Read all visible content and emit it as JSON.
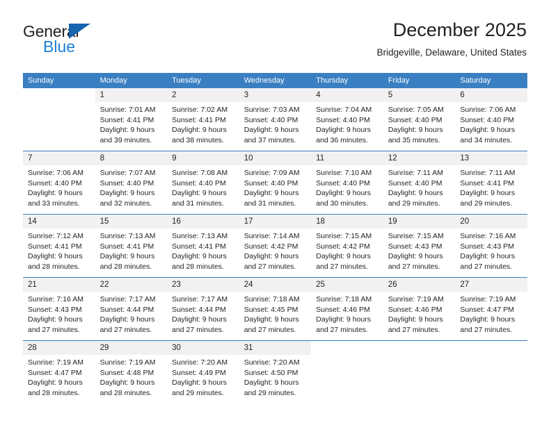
{
  "logo": {
    "word_top": "General",
    "word_bottom": "Blue",
    "triangle_name": "blue-triangle-mark",
    "color_black": "#231f20",
    "color_blue": "#1b7fd4"
  },
  "header": {
    "title": "December 2025",
    "subtitle": "Bridgeville, Delaware, United States"
  },
  "theme": {
    "header_blue": "#3a7fc1",
    "daynum_gray": "#f1f1f1",
    "text": "#231f20"
  },
  "weekday_headers": [
    "Sunday",
    "Monday",
    "Tuesday",
    "Wednesday",
    "Thursday",
    "Friday",
    "Saturday"
  ],
  "weeks": [
    {
      "days": [
        {
          "num": "",
          "lines": []
        },
        {
          "num": "1",
          "lines": [
            "Sunrise: 7:01 AM",
            "Sunset: 4:41 PM",
            "Daylight: 9 hours",
            "and 39 minutes."
          ]
        },
        {
          "num": "2",
          "lines": [
            "Sunrise: 7:02 AM",
            "Sunset: 4:41 PM",
            "Daylight: 9 hours",
            "and 38 minutes."
          ]
        },
        {
          "num": "3",
          "lines": [
            "Sunrise: 7:03 AM",
            "Sunset: 4:40 PM",
            "Daylight: 9 hours",
            "and 37 minutes."
          ]
        },
        {
          "num": "4",
          "lines": [
            "Sunrise: 7:04 AM",
            "Sunset: 4:40 PM",
            "Daylight: 9 hours",
            "and 36 minutes."
          ]
        },
        {
          "num": "5",
          "lines": [
            "Sunrise: 7:05 AM",
            "Sunset: 4:40 PM",
            "Daylight: 9 hours",
            "and 35 minutes."
          ]
        },
        {
          "num": "6",
          "lines": [
            "Sunrise: 7:06 AM",
            "Sunset: 4:40 PM",
            "Daylight: 9 hours",
            "and 34 minutes."
          ]
        }
      ]
    },
    {
      "days": [
        {
          "num": "7",
          "lines": [
            "Sunrise: 7:06 AM",
            "Sunset: 4:40 PM",
            "Daylight: 9 hours",
            "and 33 minutes."
          ]
        },
        {
          "num": "8",
          "lines": [
            "Sunrise: 7:07 AM",
            "Sunset: 4:40 PM",
            "Daylight: 9 hours",
            "and 32 minutes."
          ]
        },
        {
          "num": "9",
          "lines": [
            "Sunrise: 7:08 AM",
            "Sunset: 4:40 PM",
            "Daylight: 9 hours",
            "and 31 minutes."
          ]
        },
        {
          "num": "10",
          "lines": [
            "Sunrise: 7:09 AM",
            "Sunset: 4:40 PM",
            "Daylight: 9 hours",
            "and 31 minutes."
          ]
        },
        {
          "num": "11",
          "lines": [
            "Sunrise: 7:10 AM",
            "Sunset: 4:40 PM",
            "Daylight: 9 hours",
            "and 30 minutes."
          ]
        },
        {
          "num": "12",
          "lines": [
            "Sunrise: 7:11 AM",
            "Sunset: 4:40 PM",
            "Daylight: 9 hours",
            "and 29 minutes."
          ]
        },
        {
          "num": "13",
          "lines": [
            "Sunrise: 7:11 AM",
            "Sunset: 4:41 PM",
            "Daylight: 9 hours",
            "and 29 minutes."
          ]
        }
      ]
    },
    {
      "days": [
        {
          "num": "14",
          "lines": [
            "Sunrise: 7:12 AM",
            "Sunset: 4:41 PM",
            "Daylight: 9 hours",
            "and 28 minutes."
          ]
        },
        {
          "num": "15",
          "lines": [
            "Sunrise: 7:13 AM",
            "Sunset: 4:41 PM",
            "Daylight: 9 hours",
            "and 28 minutes."
          ]
        },
        {
          "num": "16",
          "lines": [
            "Sunrise: 7:13 AM",
            "Sunset: 4:41 PM",
            "Daylight: 9 hours",
            "and 28 minutes."
          ]
        },
        {
          "num": "17",
          "lines": [
            "Sunrise: 7:14 AM",
            "Sunset: 4:42 PM",
            "Daylight: 9 hours",
            "and 27 minutes."
          ]
        },
        {
          "num": "18",
          "lines": [
            "Sunrise: 7:15 AM",
            "Sunset: 4:42 PM",
            "Daylight: 9 hours",
            "and 27 minutes."
          ]
        },
        {
          "num": "19",
          "lines": [
            "Sunrise: 7:15 AM",
            "Sunset: 4:43 PM",
            "Daylight: 9 hours",
            "and 27 minutes."
          ]
        },
        {
          "num": "20",
          "lines": [
            "Sunrise: 7:16 AM",
            "Sunset: 4:43 PM",
            "Daylight: 9 hours",
            "and 27 minutes."
          ]
        }
      ]
    },
    {
      "days": [
        {
          "num": "21",
          "lines": [
            "Sunrise: 7:16 AM",
            "Sunset: 4:43 PM",
            "Daylight: 9 hours",
            "and 27 minutes."
          ]
        },
        {
          "num": "22",
          "lines": [
            "Sunrise: 7:17 AM",
            "Sunset: 4:44 PM",
            "Daylight: 9 hours",
            "and 27 minutes."
          ]
        },
        {
          "num": "23",
          "lines": [
            "Sunrise: 7:17 AM",
            "Sunset: 4:44 PM",
            "Daylight: 9 hours",
            "and 27 minutes."
          ]
        },
        {
          "num": "24",
          "lines": [
            "Sunrise: 7:18 AM",
            "Sunset: 4:45 PM",
            "Daylight: 9 hours",
            "and 27 minutes."
          ]
        },
        {
          "num": "25",
          "lines": [
            "Sunrise: 7:18 AM",
            "Sunset: 4:46 PM",
            "Daylight: 9 hours",
            "and 27 minutes."
          ]
        },
        {
          "num": "26",
          "lines": [
            "Sunrise: 7:19 AM",
            "Sunset: 4:46 PM",
            "Daylight: 9 hours",
            "and 27 minutes."
          ]
        },
        {
          "num": "27",
          "lines": [
            "Sunrise: 7:19 AM",
            "Sunset: 4:47 PM",
            "Daylight: 9 hours",
            "and 27 minutes."
          ]
        }
      ]
    },
    {
      "days": [
        {
          "num": "28",
          "lines": [
            "Sunrise: 7:19 AM",
            "Sunset: 4:47 PM",
            "Daylight: 9 hours",
            "and 28 minutes."
          ]
        },
        {
          "num": "29",
          "lines": [
            "Sunrise: 7:19 AM",
            "Sunset: 4:48 PM",
            "Daylight: 9 hours",
            "and 28 minutes."
          ]
        },
        {
          "num": "30",
          "lines": [
            "Sunrise: 7:20 AM",
            "Sunset: 4:49 PM",
            "Daylight: 9 hours",
            "and 29 minutes."
          ]
        },
        {
          "num": "31",
          "lines": [
            "Sunrise: 7:20 AM",
            "Sunset: 4:50 PM",
            "Daylight: 9 hours",
            "and 29 minutes."
          ]
        },
        {
          "num": "",
          "lines": []
        },
        {
          "num": "",
          "lines": []
        },
        {
          "num": "",
          "lines": []
        }
      ]
    }
  ]
}
